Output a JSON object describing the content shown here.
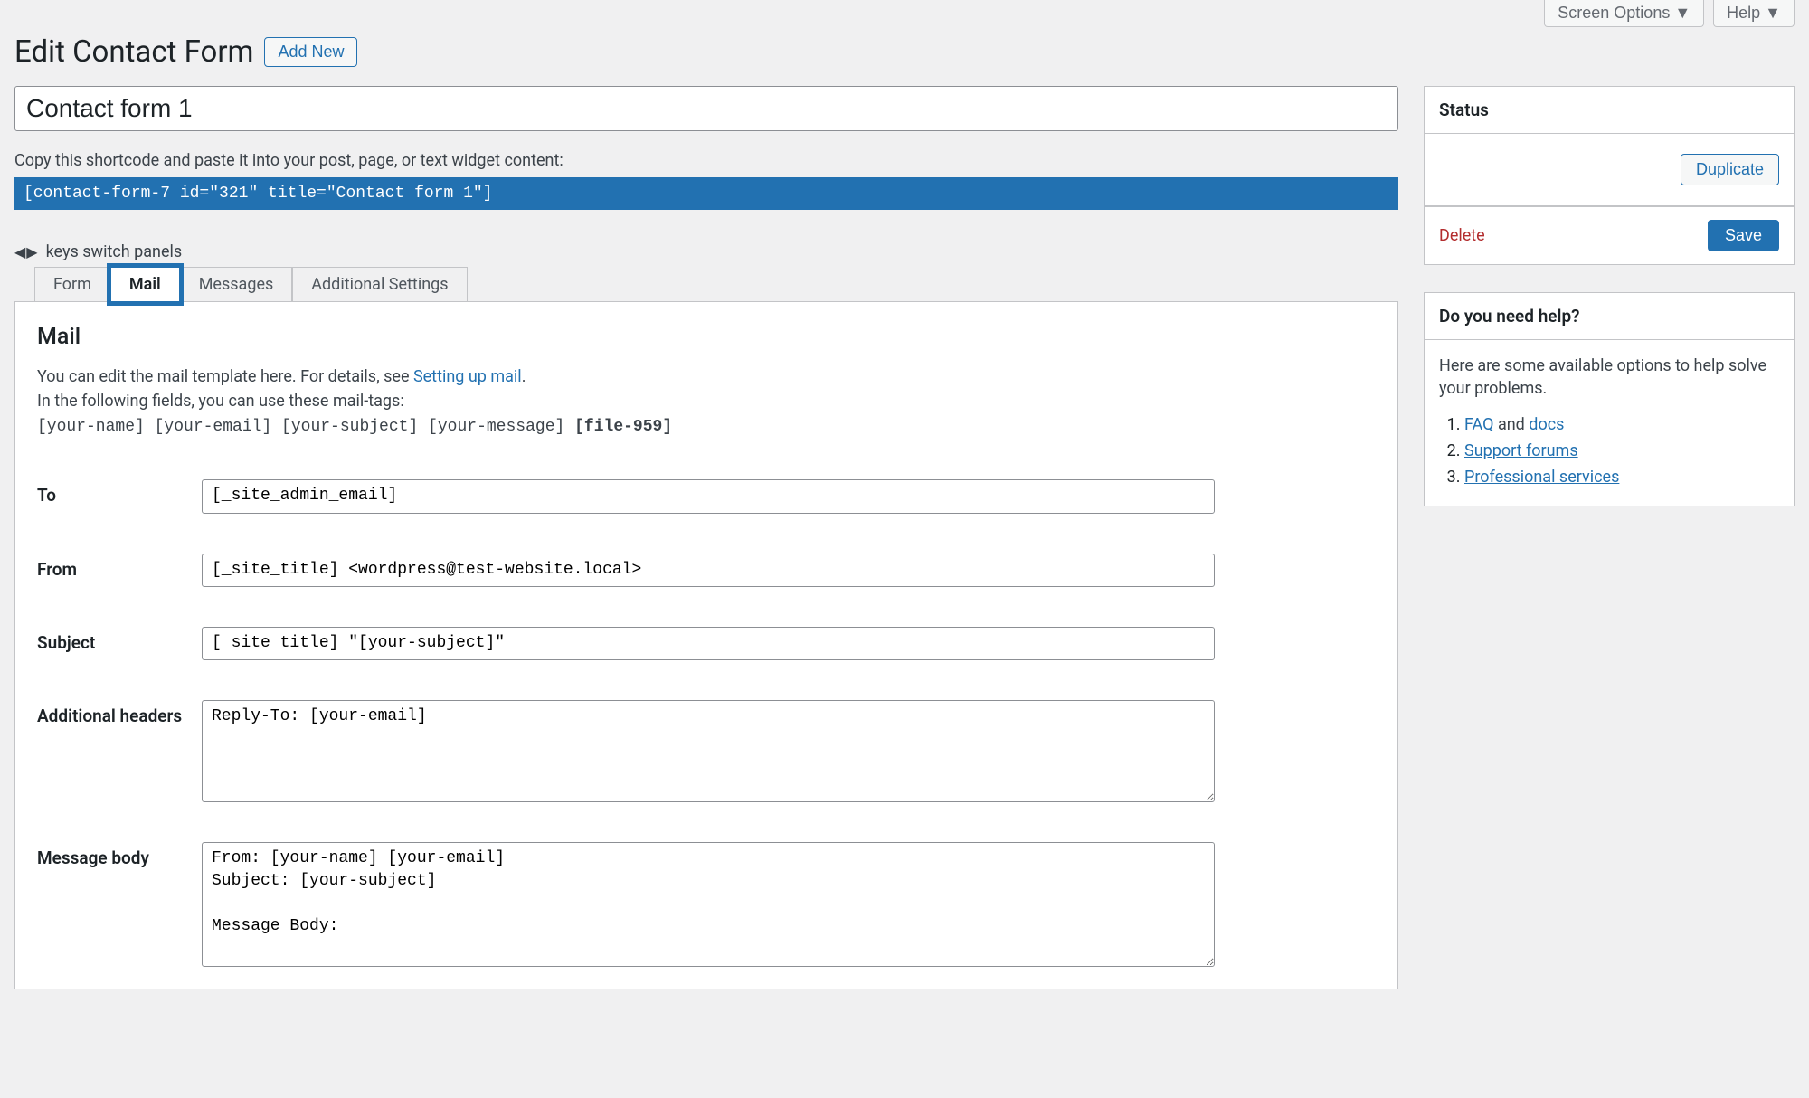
{
  "top": {
    "screen_options": "Screen Options ▼",
    "help": "Help ▼"
  },
  "header": {
    "title": "Edit Contact Form",
    "add_new": "Add New"
  },
  "form_title": "Contact form 1",
  "shortcode_help": "Copy this shortcode and paste it into your post, page, or text widget content:",
  "shortcode": "[contact-form-7 id=\"321\" title=\"Contact form 1\"]",
  "keyboard_hint": "keys switch panels",
  "tabs": {
    "form": "Form",
    "mail": "Mail",
    "messages": "Messages",
    "additional": "Additional Settings"
  },
  "mail_panel": {
    "heading": "Mail",
    "desc_prefix": "You can edit the mail template here. For details, see ",
    "desc_link": "Setting up mail",
    "desc_suffix": ".",
    "tags_intro": "In the following fields, you can use these mail-tags:",
    "tags_line": " [your-name] [your-email] [your-subject] [your-message] ",
    "bold_tag": "[file-959]",
    "fields": {
      "to_label": "To",
      "to_value": "[_site_admin_email]",
      "from_label": "From",
      "from_value": "[_site_title] <wordpress@test-website.local>",
      "subject_label": "Subject",
      "subject_value": "[_site_title] \"[your-subject]\"",
      "headers_label": "Additional headers",
      "headers_value": "Reply-To: [your-email]",
      "body_label": "Message body",
      "body_value": "From: [your-name] [your-email]\nSubject: [your-subject]\n\nMessage Body:"
    }
  },
  "sidebar": {
    "status_title": "Status",
    "duplicate": "Duplicate",
    "delete": "Delete",
    "save": "Save",
    "help_title": "Do you need help?",
    "help_text": "Here are some available options to help solve your problems.",
    "links": {
      "faq": "FAQ",
      "and": " and ",
      "docs": "docs",
      "forums": "Support forums",
      "pro": "Professional services"
    }
  }
}
